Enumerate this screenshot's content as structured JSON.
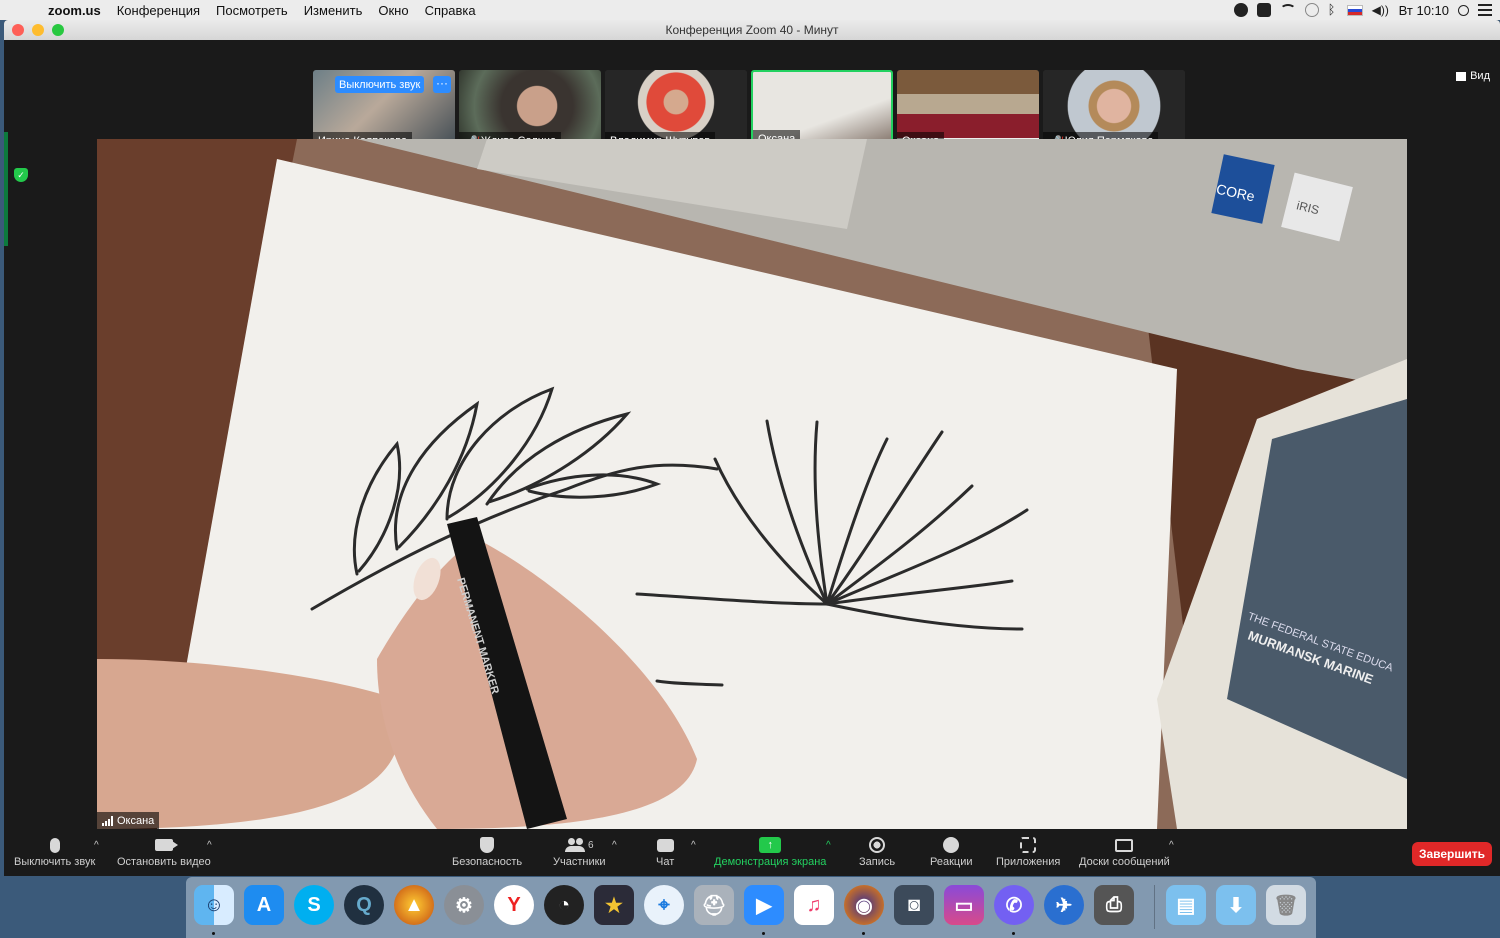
{
  "menubar": {
    "app_name": "zoom.us",
    "items": [
      "Конференция",
      "Посмотреть",
      "Изменить",
      "Окно",
      "Справка"
    ],
    "clock": "Вт 10:10"
  },
  "window": {
    "title": "Конференция Zoom   40 - Минут"
  },
  "view_label": "Вид",
  "thumbnails": [
    {
      "name": "Ирина Колпакова",
      "muted": false
    },
    {
      "name": "Ждите Солнца",
      "muted": true
    },
    {
      "name": "Владимир Шурупов",
      "muted": false
    },
    {
      "name": "Оксана",
      "muted": false
    },
    {
      "name": "Оксана",
      "muted": false
    },
    {
      "name": "Юлия Пермякова",
      "muted": true
    }
  ],
  "hover_controls": {
    "mute_label": "Выключить звук",
    "more_label": "···"
  },
  "main_speaker": "Оксана",
  "paper_text": {
    "marker_label": "PERMANENT MARKER",
    "sticker1": "CORe",
    "sticker2": "iRIS",
    "book_line1": "THE FEDERAL STATE EDUCA",
    "book_line2": "MURMANSK MARINE"
  },
  "toolbar": {
    "mute": "Выключить звук",
    "stop_video": "Остановить видео",
    "security": "Безопасность",
    "participants": "Участники",
    "participants_count": "6",
    "chat": "Чат",
    "share_screen": "Демонстрация экрана",
    "record": "Запись",
    "reactions": "Реакции",
    "apps": "Приложения",
    "boards": "Доски сообщений",
    "end": "Завершить"
  },
  "colors": {
    "accent_green": "#23d160",
    "zoom_blue": "#2d8cff",
    "end_red": "#e02828"
  },
  "dock_icons": [
    "finder-icon",
    "app-store-icon",
    "skype-icon",
    "quicktime-icon",
    "burn-icon",
    "system-preferences-icon",
    "yandex-browser-icon",
    "dashboard-icon",
    "imovie-icon",
    "safari-icon",
    "disk-utility-icon",
    "zoom-icon",
    "itunes-icon",
    "firefox-icon",
    "screenshot-icon",
    "imac-icon",
    "viber-icon",
    "mail-icon",
    "printer-icon",
    "folder-documents-icon",
    "folder-downloads-icon",
    "trash-icon"
  ]
}
